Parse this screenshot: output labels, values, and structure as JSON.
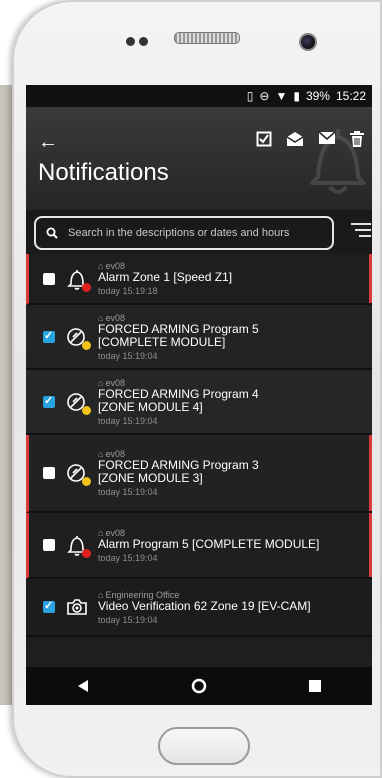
{
  "status_bar": {
    "battery": "39%",
    "time": "15:22"
  },
  "header": {
    "title": "Notifications"
  },
  "search": {
    "placeholder": "Search in the descriptions or dates and hours"
  },
  "notifications": [
    {
      "source": "ev08",
      "description": "Alarm Zone 1 [Speed Z1]",
      "time": "today 15:19:18",
      "checked": false,
      "icon": "bell-icon",
      "dot": "#e02020",
      "alarm": true
    },
    {
      "source": "ev08",
      "description": "FORCED ARMING Program 5 [COMPLETE MODULE]",
      "time": "today 15:19:04",
      "checked": true,
      "icon": "forced-arming-icon",
      "dot": "#f2c318",
      "alarm": false
    },
    {
      "source": "ev08",
      "description": "FORCED ARMING Program 4 [ZONE MODULE 4]",
      "time": "today 15:19:04",
      "checked": true,
      "icon": "forced-arming-icon",
      "dot": "#f2c318",
      "alarm": false
    },
    {
      "source": "ev08",
      "description": "FORCED ARMING Program 3 [ZONE MODULE 3]",
      "time": "today 15:19:04",
      "checked": false,
      "icon": "forced-arming-icon",
      "dot": "#f2c318",
      "alarm": true
    },
    {
      "source": "ev08",
      "description": "Alarm Program 5 [COMPLETE MODULE]",
      "time": "today 15:19:04",
      "checked": false,
      "icon": "bell-icon",
      "dot": "#e02020",
      "alarm": true
    },
    {
      "source": "Engineering Office",
      "description": "Video Verification 62 Zone 19 [EV-CAM]",
      "time": "today 15:19:04",
      "checked": true,
      "icon": "camera-icon",
      "dot": "",
      "alarm": false
    }
  ],
  "colors": {
    "checkbox_checked": "#29a3e0",
    "alarm_stripe": "#d93a3a"
  }
}
